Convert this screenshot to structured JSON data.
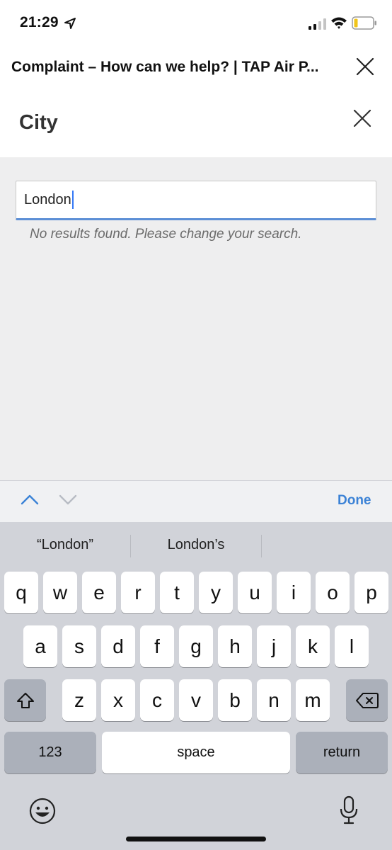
{
  "status_bar": {
    "time": "21:29"
  },
  "web_header": {
    "title": "Complaint – How can we help? | TAP Air P..."
  },
  "modal": {
    "title": "City"
  },
  "search": {
    "value": "London",
    "message": "No results found. Please change your search."
  },
  "accessory": {
    "done_label": "Done"
  },
  "keyboard": {
    "suggestions": [
      "“London”",
      "London’s"
    ],
    "row1": [
      "q",
      "w",
      "e",
      "r",
      "t",
      "y",
      "u",
      "i",
      "o",
      "p"
    ],
    "row2": [
      "a",
      "s",
      "d",
      "f",
      "g",
      "h",
      "j",
      "k",
      "l"
    ],
    "row3": [
      "z",
      "x",
      "c",
      "v",
      "b",
      "n",
      "m"
    ],
    "numbers_label": "123",
    "space_label": "space",
    "return_label": "return"
  },
  "colors": {
    "accent": "#3b82d6",
    "input_focus": "#5c8fd6",
    "keyboard_bg": "#d1d3d9"
  }
}
